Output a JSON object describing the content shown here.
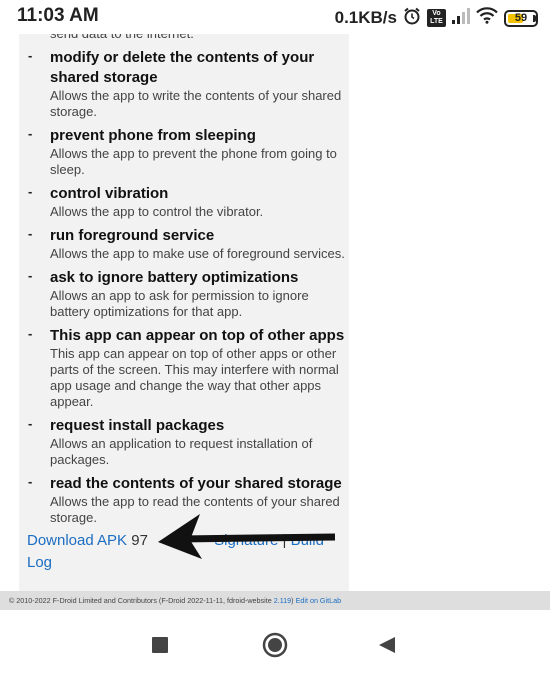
{
  "status": {
    "time": "11:03 AM",
    "net_speed": "0.1KB/s",
    "volte": "Vo LTE",
    "battery_pct": "59",
    "battery_level": 0.59
  },
  "permissions": [
    {
      "title": "",
      "desc": "send data to the internet."
    },
    {
      "title": "modify or delete the contents of your shared storage",
      "desc": "Allows the app to write the contents of your shared storage."
    },
    {
      "title": "prevent phone from sleeping",
      "desc": "Allows the app to prevent the phone from going to sleep."
    },
    {
      "title": "control vibration",
      "desc": "Allows the app to control the vibrator."
    },
    {
      "title": "run foreground service",
      "desc": "Allows the app to make use of foreground services."
    },
    {
      "title": "ask to ignore battery optimizations",
      "desc": "Allows an app to ask for permission to ignore battery optimizations for that app."
    },
    {
      "title": "This app can appear on top of other apps",
      "desc": "This app can appear on top of other apps or other parts of the screen. This may interfere with normal app usage and change the way that other apps appear."
    },
    {
      "title": "request install packages",
      "desc": "Allows an application to request installation of packages."
    },
    {
      "title": "read the contents of your shared storage",
      "desc": "Allows the app to read the contents of your shared storage."
    }
  ],
  "download": {
    "apk_label": "Download APK",
    "size_partial": "97",
    "signature_label": "Signature",
    "separator": "|",
    "build_label": "Build",
    "log_label": "Log"
  },
  "footer": {
    "text": "© 2010-2022 F-Droid Limited and Contributors (F-Droid 2022-11-11, fdroid-website ",
    "version_link": "2.119",
    "close_paren": ")",
    "gitlab_link": "Edit on GitLab"
  },
  "colors": {
    "link": "#1b6dc1",
    "battery": "#f2c200"
  }
}
